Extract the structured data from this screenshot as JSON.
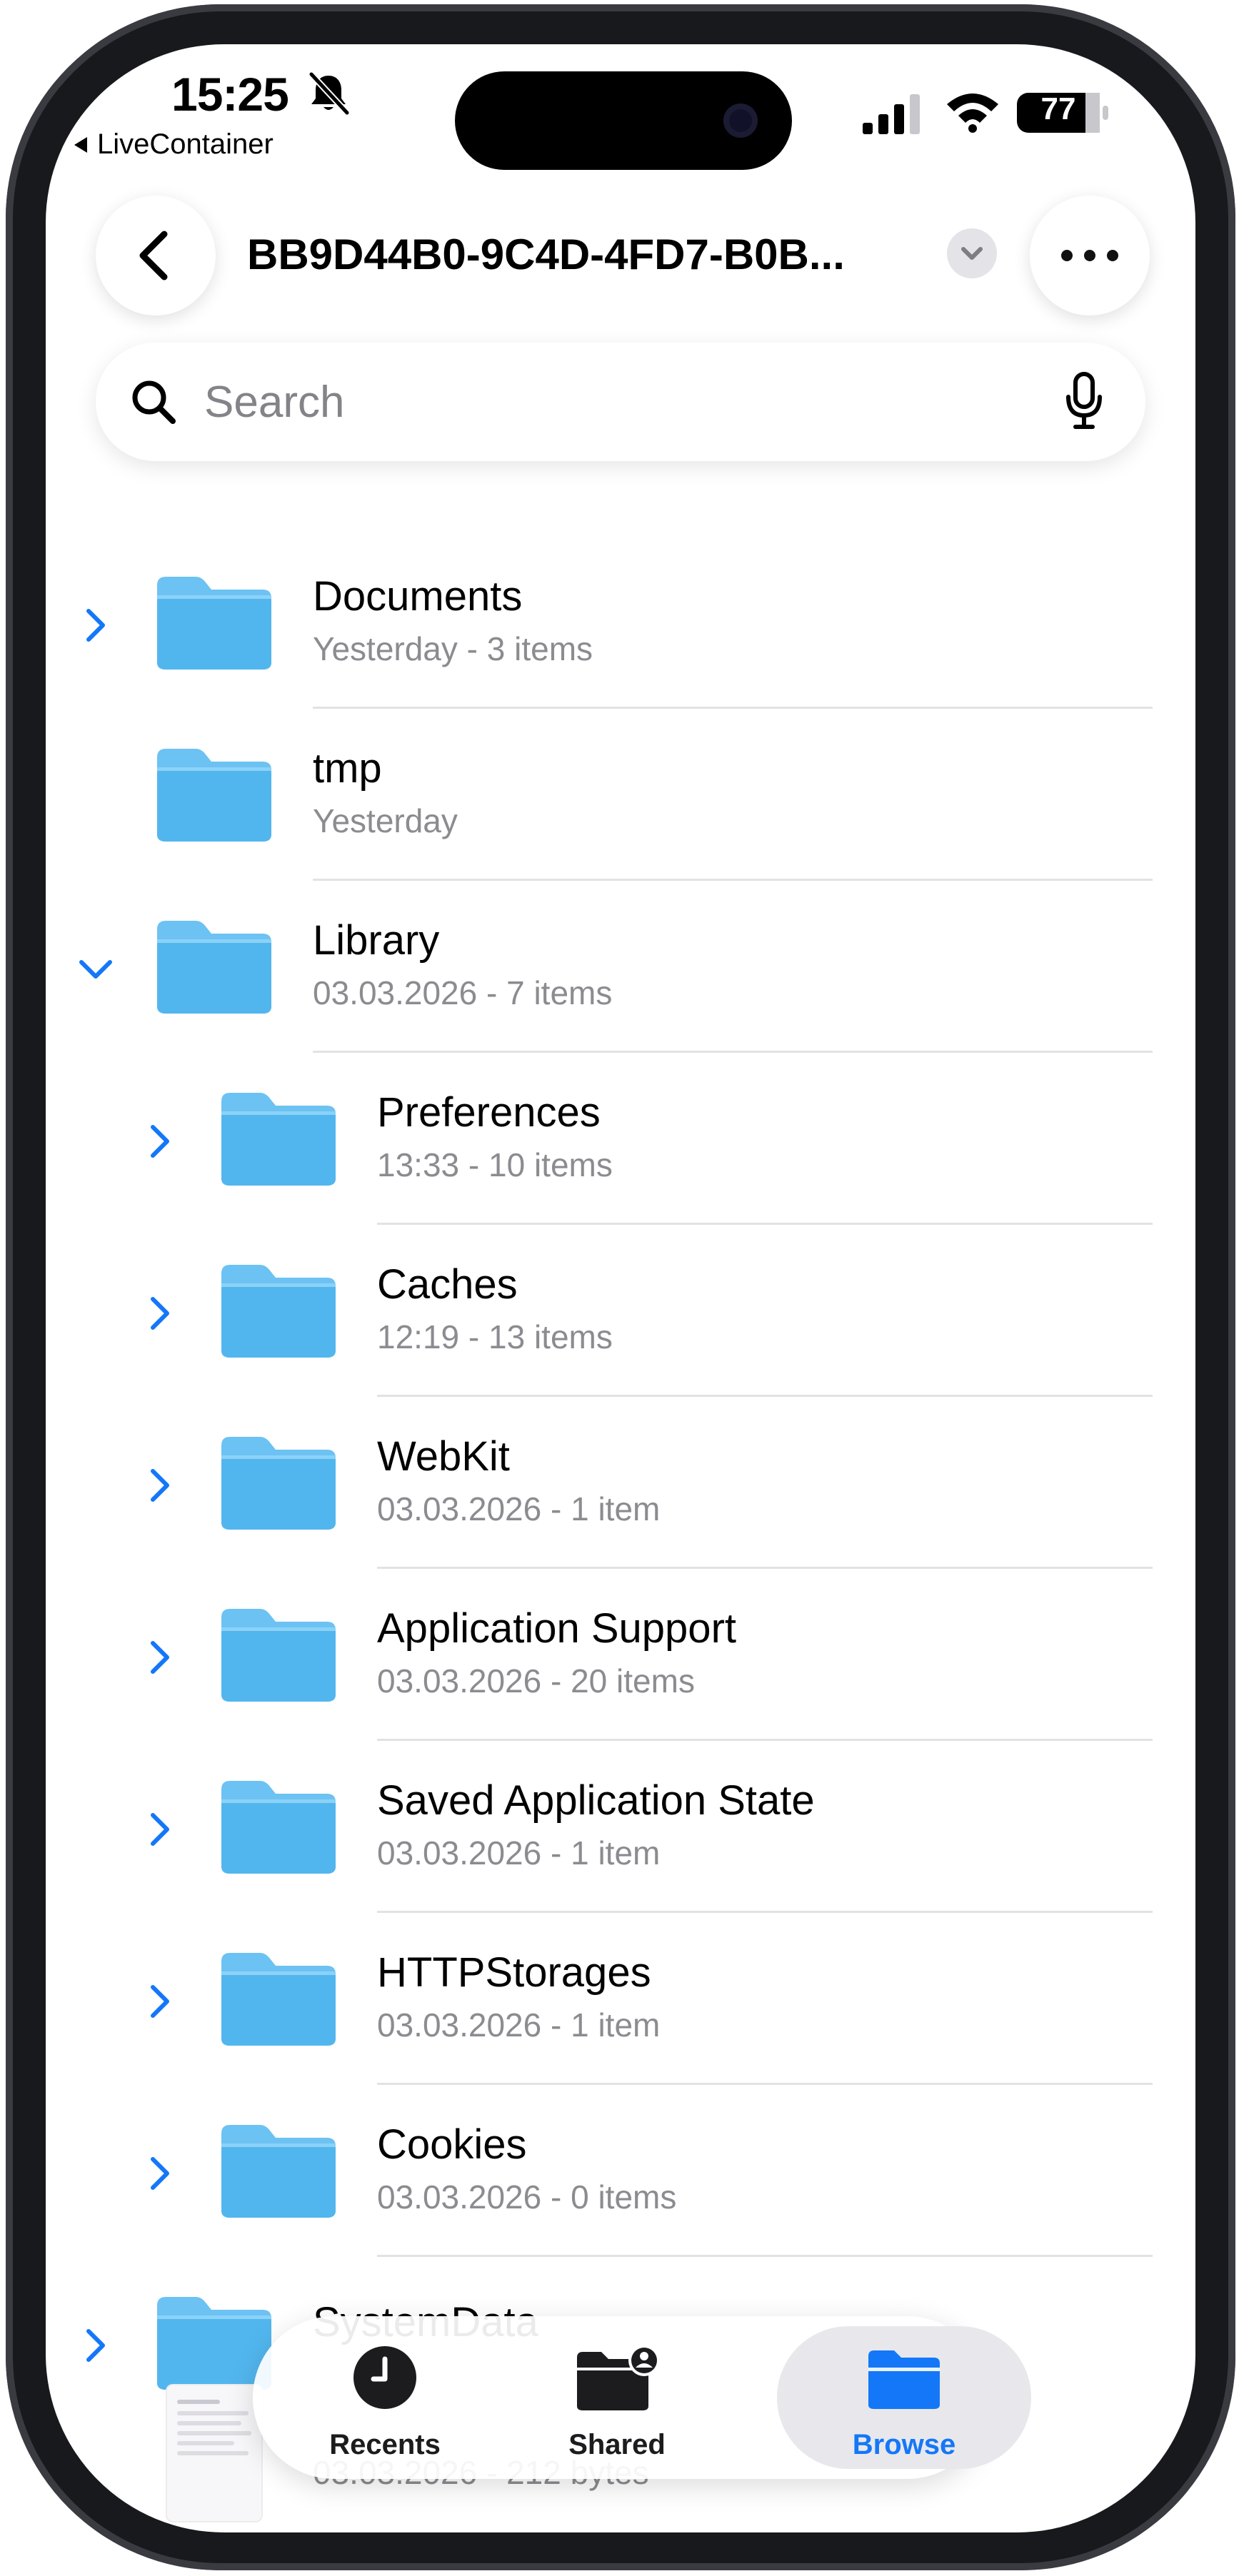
{
  "status_bar": {
    "time": "15:25",
    "back_app": "LiveContainer",
    "battery": "77",
    "icons": [
      "bell-slash-icon",
      "cellular-signal-icon",
      "wifi-icon",
      "battery-icon"
    ]
  },
  "nav": {
    "title": "BB9D44B0-9C4D-4FD7-B0B...",
    "back_icon": "chevron-left-icon",
    "title_menu_icon": "chevron-down-icon",
    "more_icon": "ellipsis-icon"
  },
  "search": {
    "placeholder": "Search",
    "icon": "magnifier-icon",
    "mic_icon": "microphone-icon"
  },
  "items": [
    {
      "name": "Documents",
      "meta": "Yesterday - 3 items",
      "level": 0,
      "chevron": "right"
    },
    {
      "name": "tmp",
      "meta": "Yesterday",
      "level": 0,
      "chevron": "none"
    },
    {
      "name": "Library",
      "meta": "03.03.2026 - 7 items",
      "level": 0,
      "chevron": "down"
    },
    {
      "name": "Preferences",
      "meta": "13:33 - 10 items",
      "level": 1,
      "chevron": "right"
    },
    {
      "name": "Caches",
      "meta": "12:19 - 13 items",
      "level": 1,
      "chevron": "right"
    },
    {
      "name": "WebKit",
      "meta": "03.03.2026 - 1 item",
      "level": 1,
      "chevron": "right"
    },
    {
      "name": "Application Support",
      "meta": "03.03.2026 - 20 items",
      "level": 1,
      "chevron": "right"
    },
    {
      "name": "Saved Application State",
      "meta": "03.03.2026 - 1 item",
      "level": 1,
      "chevron": "right"
    },
    {
      "name": "HTTPStorages",
      "meta": "03.03.2026 - 1 item",
      "level": 1,
      "chevron": "right"
    },
    {
      "name": "Cookies",
      "meta": "03.03.2026 - 0 items",
      "level": 1,
      "chevron": "right"
    },
    {
      "name": "SystemData",
      "meta": "",
      "level": 0,
      "chevron": "right"
    }
  ],
  "partial_file": {
    "name": "",
    "meta": "03.03.2026 - 212 bytes"
  },
  "tabs": [
    {
      "label": "Recents",
      "icon": "clock-icon",
      "active": false
    },
    {
      "label": "Shared",
      "icon": "shared-folder-icon",
      "active": false
    },
    {
      "label": "Browse",
      "icon": "folder-icon",
      "active": true
    }
  ],
  "colors": {
    "accent": "#1477f8",
    "folder_top": "#7fcbf5",
    "folder_body": "#4db3ec",
    "secondary_text": "#8b8b90"
  }
}
